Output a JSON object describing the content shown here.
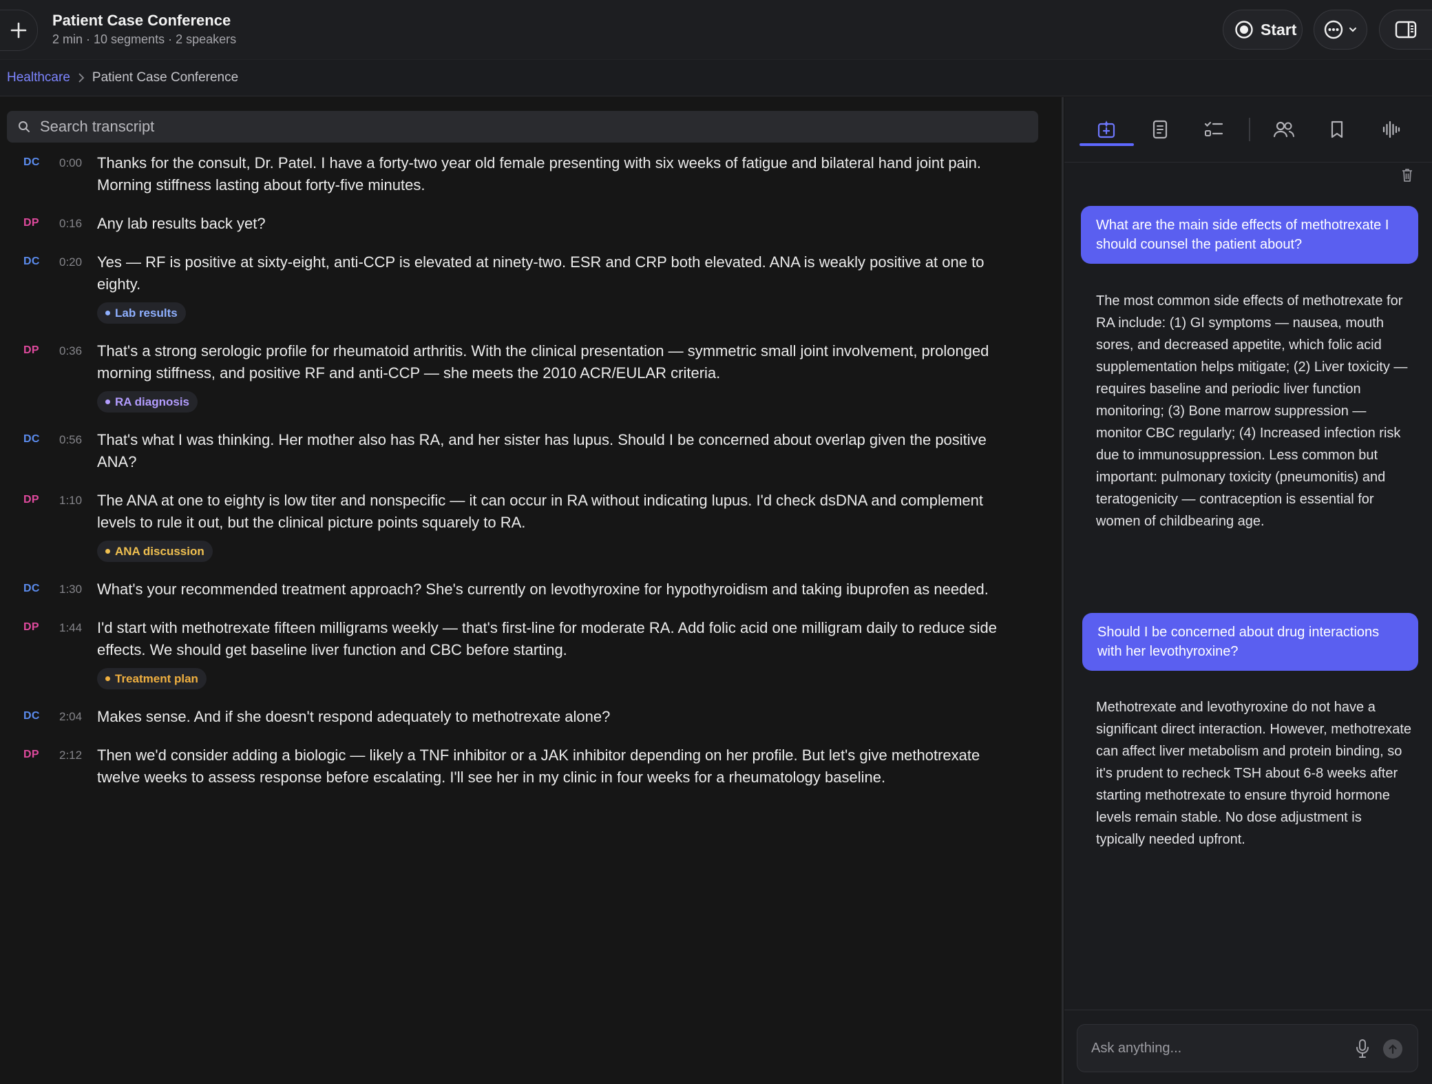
{
  "header": {
    "title": "Patient Case Conference",
    "subtitle": "2 min · 10 segments · 2 speakers",
    "start_label": "Start"
  },
  "breadcrumb": {
    "parent": "Healthcare",
    "current": "Patient Case Conference"
  },
  "search": {
    "placeholder": "Search transcript"
  },
  "colors": {
    "accent": "#5a5ff0",
    "speaker_dc": "#5c8df0",
    "speaker_dp": "#e04a9e"
  },
  "transcript": [
    {
      "speaker": "DC",
      "time": "0:00",
      "text": "Thanks for the consult, Dr. Patel. I have a forty-two year old female presenting with six weeks of fatigue and bilateral hand joint pain. Morning stiffness lasting about forty-five minutes."
    },
    {
      "speaker": "DP",
      "time": "0:16",
      "text": "Any lab results back yet?"
    },
    {
      "speaker": "DC",
      "time": "0:20",
      "text": "Yes — RF is positive at sixty-eight, anti-CCP is elevated at ninety-two. ESR and CRP both elevated. ANA is weakly positive at one to eighty.",
      "tag": {
        "label": "Lab results",
        "color": "#8fb0ff"
      }
    },
    {
      "speaker": "DP",
      "time": "0:36",
      "text": "That's a strong serologic profile for rheumatoid arthritis. With the clinical presentation — symmetric small joint involvement, prolonged morning stiffness, and positive RF and anti-CCP — she meets the 2010 ACR/EULAR criteria.",
      "tag": {
        "label": "RA diagnosis",
        "color": "#b39dff"
      }
    },
    {
      "speaker": "DC",
      "time": "0:56",
      "text": "That's what I was thinking. Her mother also has RA, and her sister has lupus. Should I be concerned about overlap given the positive ANA?"
    },
    {
      "speaker": "DP",
      "time": "1:10",
      "text": "The ANA at one to eighty is low titer and nonspecific — it can occur in RA without indicating lupus. I'd check dsDNA and complement levels to rule it out, but the clinical picture points squarely to RA.",
      "tag": {
        "label": "ANA discussion",
        "color": "#f0c050"
      }
    },
    {
      "speaker": "DC",
      "time": "1:30",
      "text": "What's your recommended treatment approach? She's currently on levothyroxine for hypothyroidism and taking ibuprofen as needed."
    },
    {
      "speaker": "DP",
      "time": "1:44",
      "text": "I'd start with methotrexate fifteen milligrams weekly — that's first-line for moderate RA. Add folic acid one milligram daily to reduce side effects. We should get baseline liver function and CBC before starting.",
      "tag": {
        "label": "Treatment plan",
        "color": "#f0b040"
      }
    },
    {
      "speaker": "DC",
      "time": "2:04",
      "text": "Makes sense. And if she doesn't respond adequately to methotrexate alone?"
    },
    {
      "speaker": "DP",
      "time": "2:12",
      "text": "Then we'd consider adding a biologic — likely a TNF inhibitor or a JAK inhibitor depending on her profile. But let's give methotrexate twelve weeks to assess response before escalating. I'll see her in my clinic in four weeks for a rheumatology baseline."
    }
  ],
  "chat": {
    "q1": "What are the main side effects of methotrexate I should counsel the patient about?",
    "a1": "The most common side effects of methotrexate for RA include: (1) GI symptoms — nausea, mouth sores, and decreased appetite, which folic acid supplementation helps mitigate; (2) Liver toxicity — requires baseline and periodic liver function monitoring; (3) Bone marrow suppression — monitor CBC regularly; (4) Increased infection risk due to immunosuppression. Less common but important: pulmonary toxicity (pneumonitis) and teratogenicity — contraception is essential for women of childbearing age.",
    "q2": "Should I be concerned about drug interactions with her levothyroxine?",
    "a2": "Methotrexate and levothyroxine do not have a significant direct interaction. However, methotrexate can affect liver metabolism and protein binding, so it's prudent to recheck TSH about 6-8 weeks after starting methotrexate to ensure thyroid hormone levels remain stable. No dose adjustment is typically needed upfront.",
    "ask_placeholder": "Ask anything..."
  }
}
